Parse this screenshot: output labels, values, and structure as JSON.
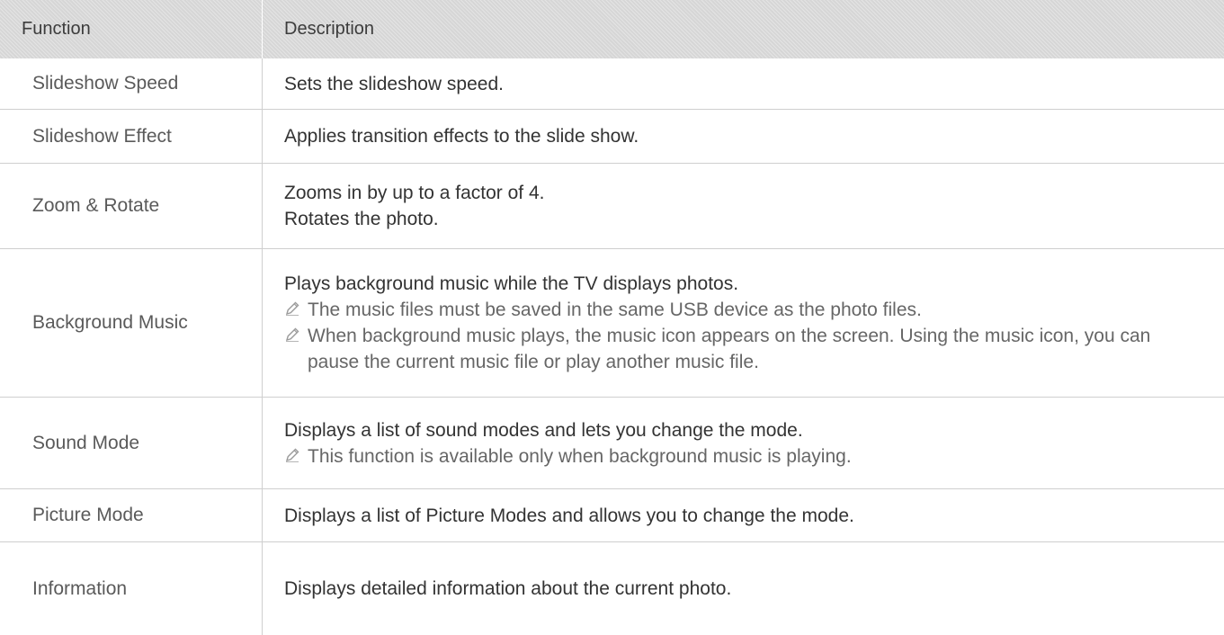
{
  "table": {
    "header": {
      "function": "Function",
      "description": "Description"
    },
    "rows": [
      {
        "function": "Slideshow Speed",
        "lines": [
          "Sets the slideshow speed."
        ],
        "notes": []
      },
      {
        "function": "Slideshow Effect",
        "lines": [
          "Applies transition effects to the slide show."
        ],
        "notes": []
      },
      {
        "function": "Zoom & Rotate",
        "lines": [
          "Zooms in by up to a factor of 4.",
          "Rotates the photo."
        ],
        "notes": []
      },
      {
        "function": "Background Music",
        "lines": [
          "Plays background music while the TV displays photos."
        ],
        "notes": [
          "The music files must be saved in the same USB device as the photo files.",
          "When background music plays, the music icon appears on the screen. Using the music icon, you can pause the current music file or play another music file."
        ]
      },
      {
        "function": "Sound Mode",
        "lines": [
          "Displays a list of sound modes and lets you change the mode."
        ],
        "notes": [
          "This function is available only when background music is playing."
        ]
      },
      {
        "function": "Picture Mode",
        "lines": [
          "Displays a list of Picture Modes and allows you to change the mode."
        ],
        "notes": []
      },
      {
        "function": "Information",
        "lines": [
          "Displays detailed information about the current photo."
        ],
        "notes": []
      }
    ]
  }
}
